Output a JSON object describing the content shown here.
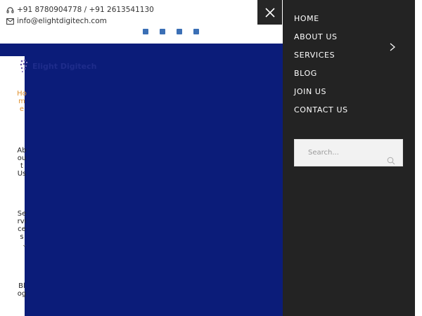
{
  "header": {
    "phone": "+91 8780904778 / +91 2613541130",
    "email": "info@elightdigitech.com",
    "phone_icon": "headset-icon",
    "email_icon": "envelope-icon",
    "socials": [
      "facebook-icon",
      "instagram-icon",
      "linkedin-icon",
      "twitter-icon"
    ],
    "social_color": "#3b6fb5"
  },
  "logo": {
    "text": "Elight Digitech"
  },
  "side_nav": {
    "items": [
      {
        "label": "Home",
        "active": true
      },
      {
        "label": "About Us"
      },
      {
        "label": "Services"
      },
      {
        "label": "Blog"
      }
    ]
  },
  "drawer": {
    "close_icon": "close-icon",
    "menu": [
      "HOME",
      "ABOUT US",
      "SERVICES",
      "BLOG",
      "JOIN US",
      "CONTACT US"
    ],
    "search": {
      "placeholder": "Search...",
      "value": ""
    }
  },
  "colors": {
    "brand_blue": "#0b1c79",
    "drawer_bg": "#232323",
    "accent": "#e0922f"
  }
}
